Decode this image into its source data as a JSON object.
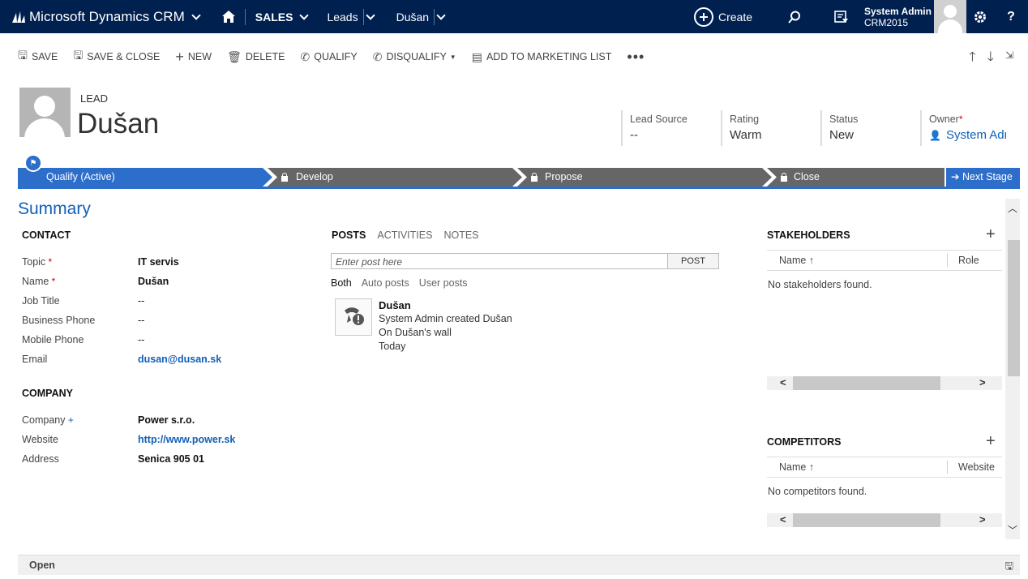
{
  "topnav": {
    "app_name": "Microsoft Dynamics CRM",
    "area": "SALES",
    "entity": "Leads",
    "record": "Dušan",
    "create": "Create",
    "user_name": "System Admin",
    "org_name": "CRM2015"
  },
  "commands": [
    {
      "label": "SAVE",
      "icon": "save-icon",
      "glyph": "🖫"
    },
    {
      "label": "SAVE & CLOSE",
      "icon": "save-close-icon",
      "glyph": "🖫"
    },
    {
      "label": "NEW",
      "icon": "plus-icon",
      "glyph": "+"
    },
    {
      "label": "DELETE",
      "icon": "trash-icon",
      "glyph": "🗑"
    },
    {
      "label": "QUALIFY",
      "icon": "phone-check-icon",
      "glyph": "✆"
    },
    {
      "label": "DISQUALIFY",
      "icon": "phone-cancel-icon",
      "glyph": "✆"
    },
    {
      "label": "ADD TO MARKETING LIST",
      "icon": "list-add-icon",
      "glyph": "▤"
    }
  ],
  "header": {
    "entity_type": "LEAD",
    "name": "Dušan",
    "fields": [
      {
        "label": "Lead Source",
        "value": "--"
      },
      {
        "label": "Rating",
        "value": "Warm"
      },
      {
        "label": "Status",
        "value": "New"
      },
      {
        "label": "Owner",
        "value": "System Admin"
      }
    ]
  },
  "process": {
    "stages": [
      {
        "label": "Qualify (Active)"
      },
      {
        "label": "Develop"
      },
      {
        "label": "Propose"
      },
      {
        "label": "Close"
      }
    ],
    "next_stage": "Next Stage"
  },
  "summary": {
    "title": "Summary",
    "contact_title": "CONTACT",
    "contact_fields": [
      {
        "label": "Topic",
        "value": "IT servis"
      },
      {
        "label": "Name",
        "value": "Dušan"
      },
      {
        "label": "Job Title",
        "value": "--"
      },
      {
        "label": "Business Phone",
        "value": "--"
      },
      {
        "label": "Mobile Phone",
        "value": "--"
      },
      {
        "label": "Email",
        "value": "dusan@dusan.sk"
      }
    ],
    "company_title": "COMPANY",
    "company_fields": [
      {
        "label": "Company",
        "value": "Power s.r.o."
      },
      {
        "label": "Website",
        "value": "http://www.power.sk"
      },
      {
        "label": "Address",
        "value": "Senica 905 01"
      }
    ]
  },
  "posts": {
    "tabs": [
      "POSTS",
      "ACTIVITIES",
      "NOTES"
    ],
    "placeholder": "Enter post here",
    "post_button": "POST",
    "filters": [
      "Both",
      "Auto posts",
      "User posts"
    ],
    "items": [
      {
        "author": "Dušan",
        "text": "System Admin created Dušan",
        "wall": "On Dušan's wall",
        "time": "Today"
      }
    ]
  },
  "stakeholders": {
    "title": "STAKEHOLDERS",
    "col1": "Name ↑",
    "col2": "Role",
    "empty": "No stakeholders found."
  },
  "competitors": {
    "title": "COMPETITORS",
    "col1": "Name ↑",
    "col2": "Website",
    "empty": "No competitors found."
  },
  "footer": {
    "status": "Open"
  }
}
